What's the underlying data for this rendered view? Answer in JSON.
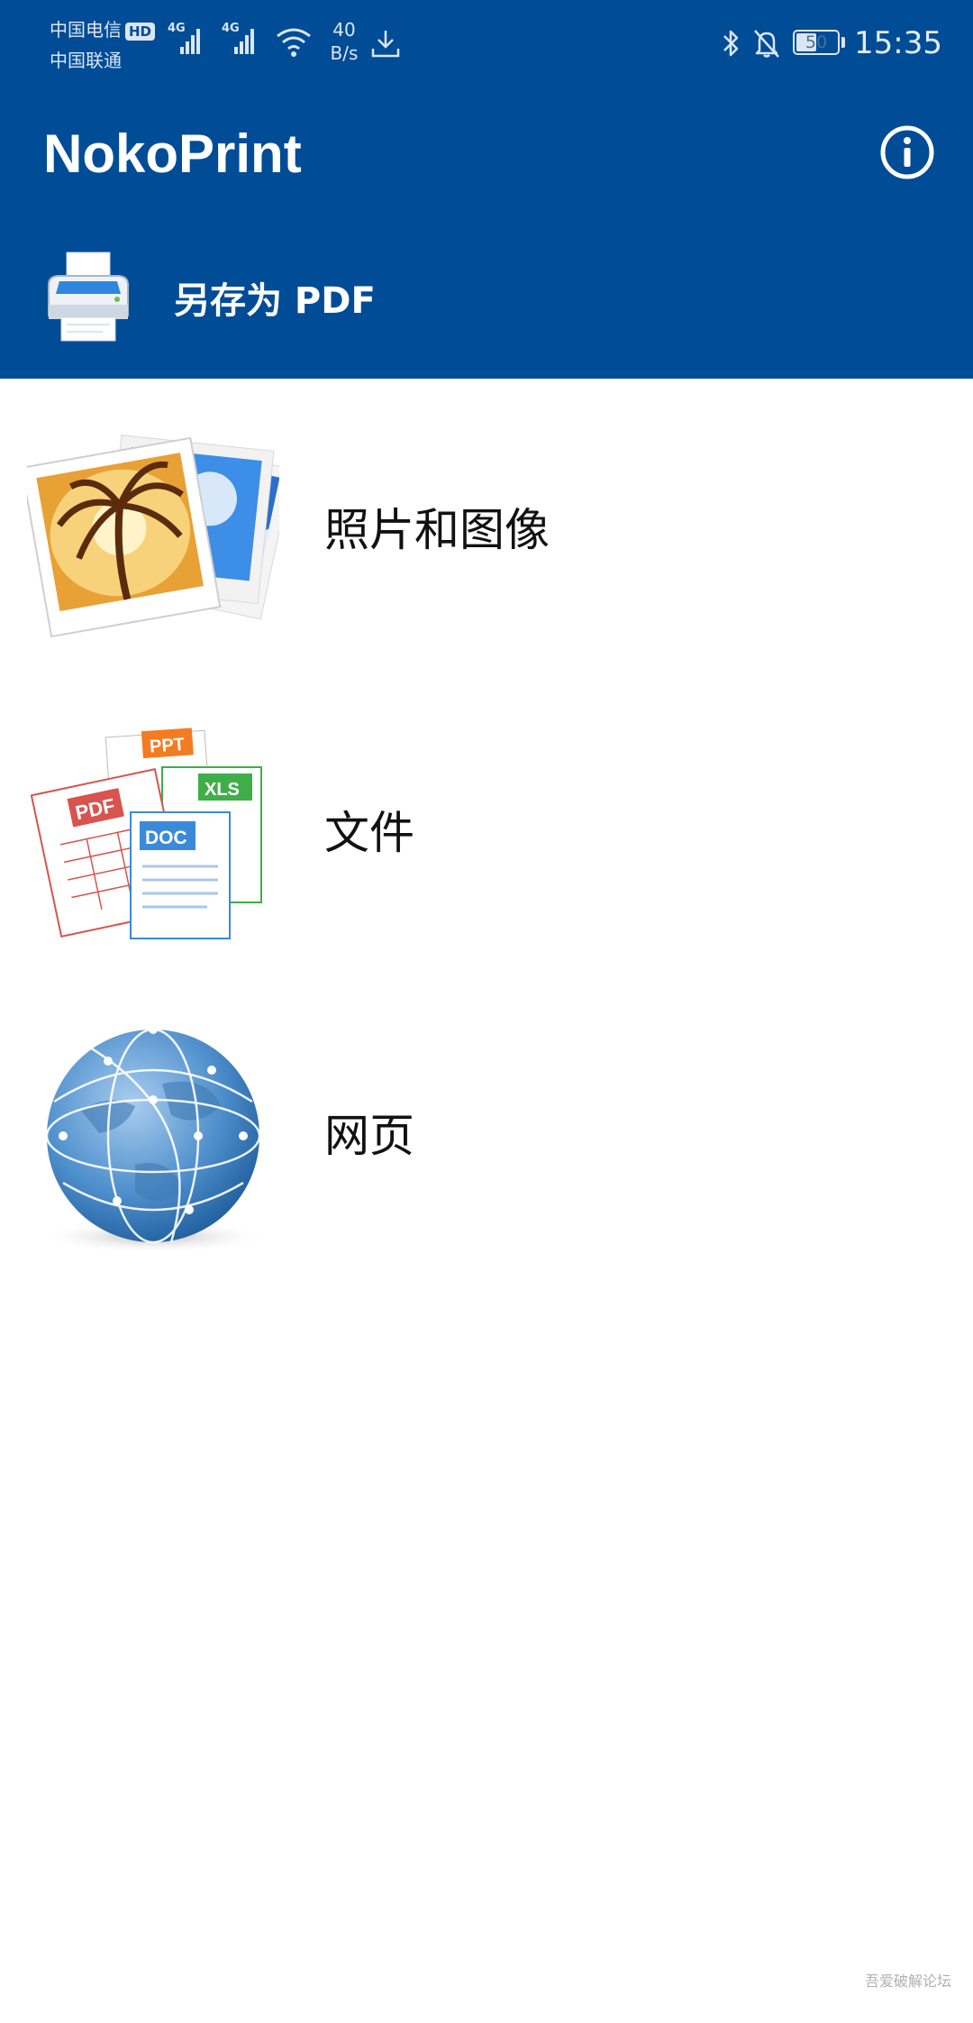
{
  "status_bar": {
    "carrier_1": "中国电信",
    "hd_badge": "HD",
    "carrier_2": "中国联通",
    "signal_1_label": "4G",
    "signal_2_label": "4G",
    "net_speed_value": "40",
    "net_speed_unit": "B/s",
    "battery_level": "50",
    "battery_fraction": 0.5,
    "time": "15:35",
    "icons": [
      "signal-icon",
      "wifi-icon",
      "download-icon",
      "bluetooth-icon",
      "mute-icon",
      "battery-icon"
    ]
  },
  "app_bar": {
    "title": "NokoPrint",
    "info_icon": "info-icon"
  },
  "header_action": {
    "label": "另存为 PDF",
    "icon": "printer-icon"
  },
  "menu": [
    {
      "label": "照片和图像",
      "icon": "photos-icon"
    },
    {
      "label": "文件",
      "icon": "documents-icon",
      "badges": [
        "PPT",
        "XLS",
        "PDF",
        "DOC"
      ]
    },
    {
      "label": "网页",
      "icon": "globe-icon"
    }
  ],
  "watermark": "吾爱破解论坛",
  "colors": {
    "header_bg": "#004c97",
    "page_bg": "#ffffff",
    "text": "#111111"
  }
}
